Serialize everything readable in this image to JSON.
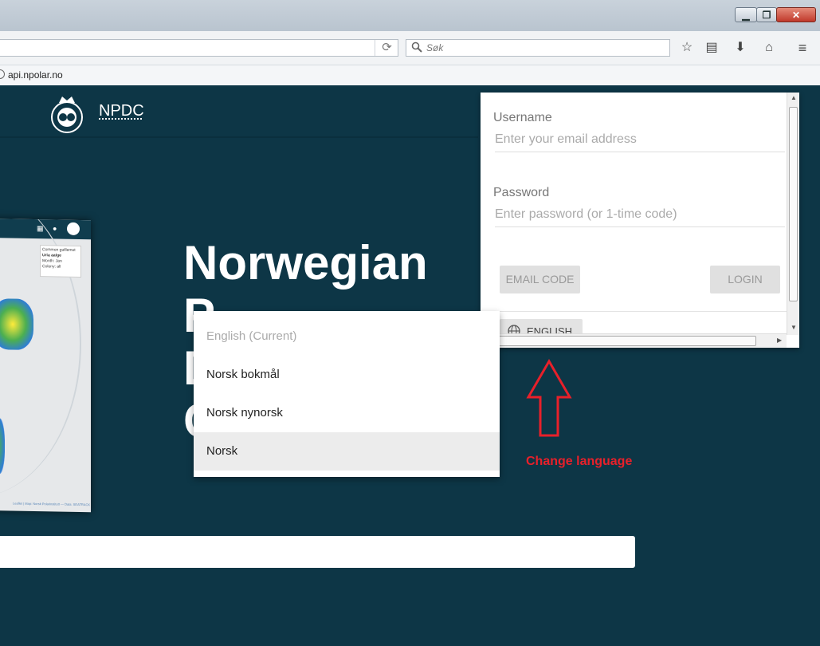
{
  "browser": {
    "search_placeholder": "Søk",
    "bookmark_label": "api.npolar.no"
  },
  "page": {
    "site_link": "NPDC",
    "hero_lines": [
      "Norwegian",
      "P",
      "D",
      "C"
    ]
  },
  "map_preview": {
    "legend_title": "Common guillemot",
    "legend_species": "Uria aalge",
    "legend_month": "Month: Jan",
    "legend_colony": "Colony: all",
    "footer": "Leaflet | Map: Norsk Polarinstitutt — Data: SEATRACK"
  },
  "login": {
    "username_label": "Username",
    "username_placeholder": "Enter your email address",
    "password_label": "Password",
    "password_placeholder": "Enter password (or 1-time code)",
    "email_code_button": "EMAIL CODE",
    "login_button": "LOGIN",
    "language_button": "ENGLISH"
  },
  "language_menu": {
    "items": [
      "English (Current)",
      "Norsk bokmål",
      "Norsk nynorsk",
      "Norsk"
    ],
    "current_index": 0,
    "highlighted_index": 3
  },
  "annotation": {
    "text": "Change language",
    "color": "#e8202a"
  },
  "colors": {
    "page_background": "#0d3646",
    "accent_annotation": "#e8202a"
  }
}
